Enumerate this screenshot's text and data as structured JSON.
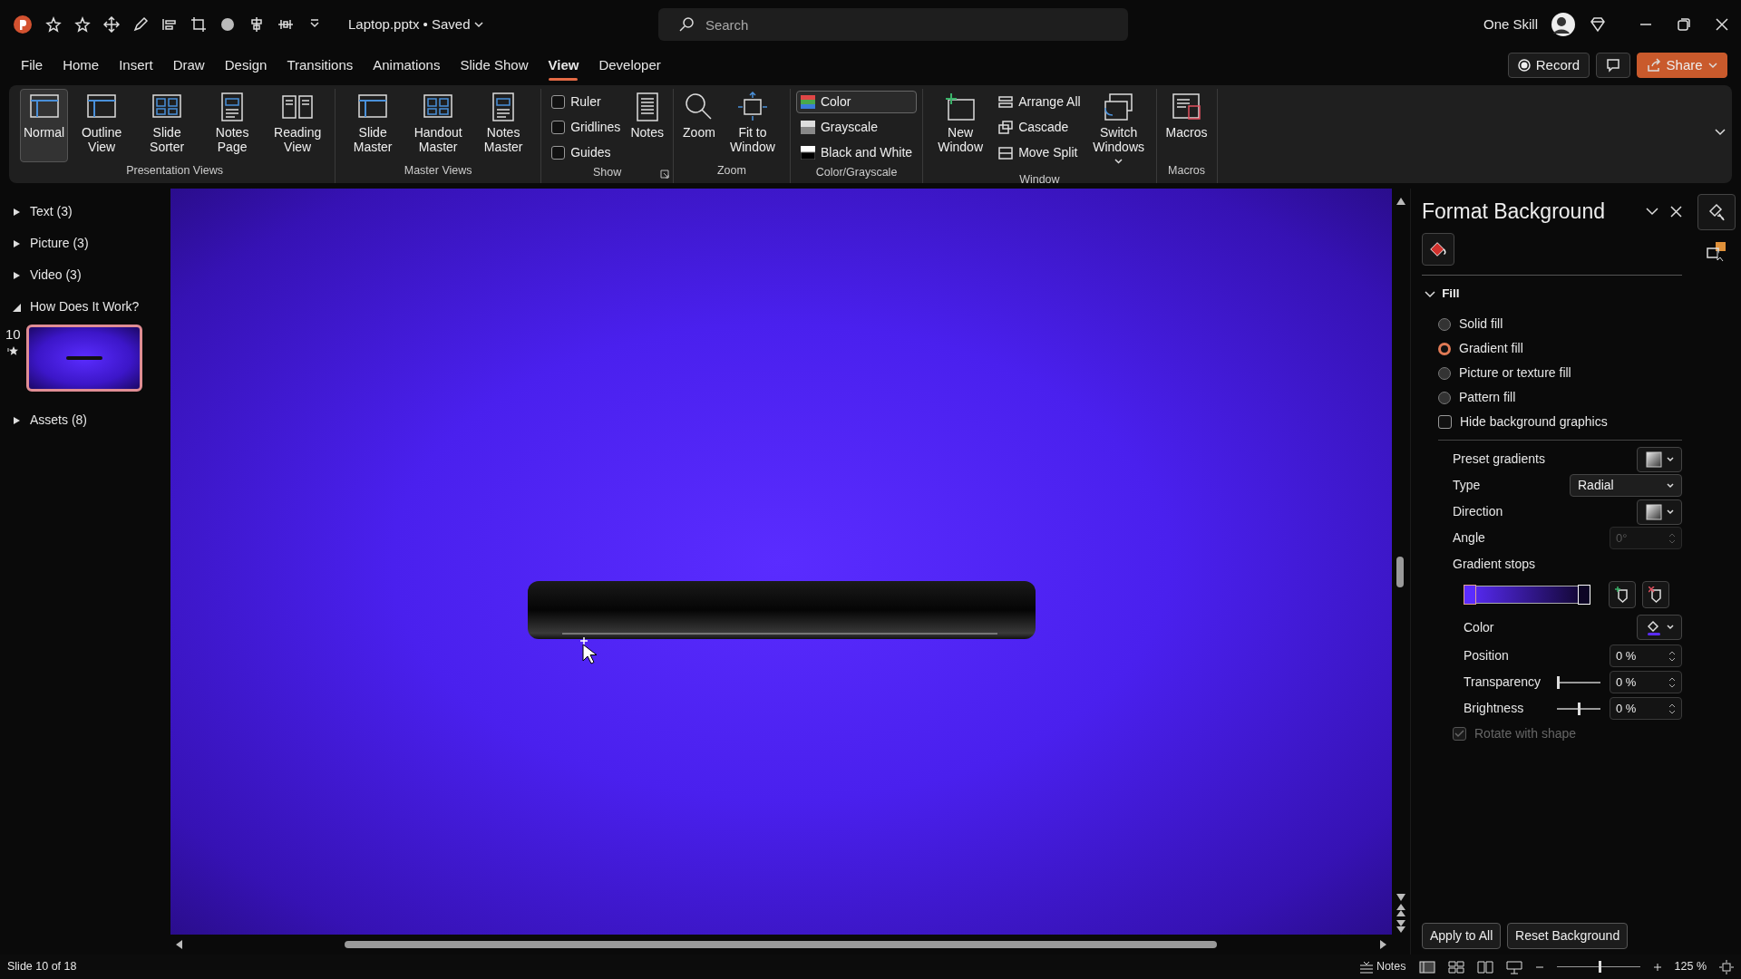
{
  "title_bar": {
    "file_name": "Laptop.pptx • Saved",
    "search": {
      "placeholder": "Search"
    },
    "user": "One Skill"
  },
  "menu": [
    {
      "label": "File",
      "selected": false
    },
    {
      "label": "Home",
      "selected": false
    },
    {
      "label": "Insert",
      "selected": false
    },
    {
      "label": "Draw",
      "selected": false
    },
    {
      "label": "Design",
      "selected": false
    },
    {
      "label": "Transitions",
      "selected": false
    },
    {
      "label": "Animations",
      "selected": false
    },
    {
      "label": "Slide Show",
      "selected": false
    },
    {
      "label": "View",
      "selected": true
    },
    {
      "label": "Developer",
      "selected": false
    }
  ],
  "ribbon_actions": {
    "record": "Record",
    "share": "Share"
  },
  "ribbon": [
    {
      "label": "Presentation Views",
      "items": [
        {
          "kind": "big",
          "label": "Normal",
          "selected": true
        },
        {
          "kind": "big",
          "label": "Outline View",
          "selected": false
        },
        {
          "kind": "big",
          "label": "Slide Sorter",
          "selected": false
        },
        {
          "kind": "big",
          "label": "Notes Page",
          "selected": false
        },
        {
          "kind": "big",
          "label": "Reading View",
          "selected": false
        }
      ]
    },
    {
      "label": "Master Views",
      "items": [
        {
          "kind": "big",
          "label": "Slide Master"
        },
        {
          "kind": "big",
          "label": "Handout Master"
        },
        {
          "kind": "big",
          "label": "Notes Master"
        }
      ]
    },
    {
      "label": "Show",
      "launcher": true,
      "items": [
        {
          "kind": "check",
          "label": "Ruler",
          "checked": false
        },
        {
          "kind": "check",
          "label": "Gridlines",
          "checked": false
        },
        {
          "kind": "check",
          "label": "Guides",
          "checked": false
        },
        {
          "kind": "big",
          "label": "Notes"
        }
      ]
    },
    {
      "label": "Zoom",
      "items": [
        {
          "kind": "big",
          "label": "Zoom"
        },
        {
          "kind": "big",
          "label": "Fit to Window"
        }
      ]
    },
    {
      "label": "Color/Grayscale",
      "items": [
        {
          "kind": "small",
          "label": "Color",
          "selected": true
        },
        {
          "kind": "small",
          "label": "Grayscale",
          "selected": false
        },
        {
          "kind": "small",
          "label": "Black and White",
          "selected": false
        }
      ]
    },
    {
      "label": "Window",
      "items": [
        {
          "kind": "big",
          "label": "New Window"
        },
        {
          "kind": "small",
          "label": "Arrange All"
        },
        {
          "kind": "small",
          "label": "Cascade"
        },
        {
          "kind": "small",
          "label": "Move Split"
        },
        {
          "kind": "big",
          "label": "Switch Windows",
          "caret": true
        }
      ]
    },
    {
      "label": "Macros",
      "items": [
        {
          "kind": "big",
          "label": "Macros"
        }
      ]
    }
  ],
  "sections": [
    {
      "label": "Text (3)",
      "expanded": false
    },
    {
      "label": "Picture (3)",
      "expanded": false
    },
    {
      "label": "Video (3)",
      "expanded": false
    },
    {
      "label": "How Does It Work?",
      "expanded": true,
      "slides": [
        {
          "number": "10",
          "selected": true
        }
      ]
    },
    {
      "label": "Assets (8)",
      "expanded": false
    }
  ],
  "format_panel": {
    "title": "Format Background",
    "section": {
      "label": "Fill",
      "expanded": true
    },
    "fill_options": [
      {
        "label": "Solid fill",
        "selected": false
      },
      {
        "label": "Gradient fill",
        "selected": true
      },
      {
        "label": "Picture or texture fill",
        "selected": false
      },
      {
        "label": "Pattern fill",
        "selected": false
      }
    ],
    "hide_graphics": {
      "label": "Hide background graphics",
      "checked": false
    },
    "preset": {
      "label": "Preset gradients"
    },
    "type": {
      "label": "Type",
      "value": "Radial"
    },
    "direction": {
      "label": "Direction"
    },
    "angle": {
      "label": "Angle",
      "value": "0°",
      "disabled": true
    },
    "stops_label": "Gradient stops",
    "stops": [
      {
        "color": "#5b2cff",
        "selected": true
      },
      {
        "color": "#0d0425",
        "selected": false
      }
    ],
    "color": {
      "label": "Color"
    },
    "position": {
      "label": "Position",
      "value": "0 %"
    },
    "transparency": {
      "label": "Transparency",
      "level": 0,
      "value": "0 %"
    },
    "brightness": {
      "label": "Brightness",
      "level": 0.5,
      "value": "0 %"
    },
    "rotate": {
      "label": "Rotate with shape",
      "checked": true,
      "disabled": true
    },
    "buttons": [
      "Apply to All",
      "Reset Background"
    ]
  },
  "status_bar": {
    "slide_info": "Slide 10 of 18",
    "notes": "Notes",
    "zoom": "125 %",
    "zoom_slider": {
      "level": 0.52
    }
  }
}
